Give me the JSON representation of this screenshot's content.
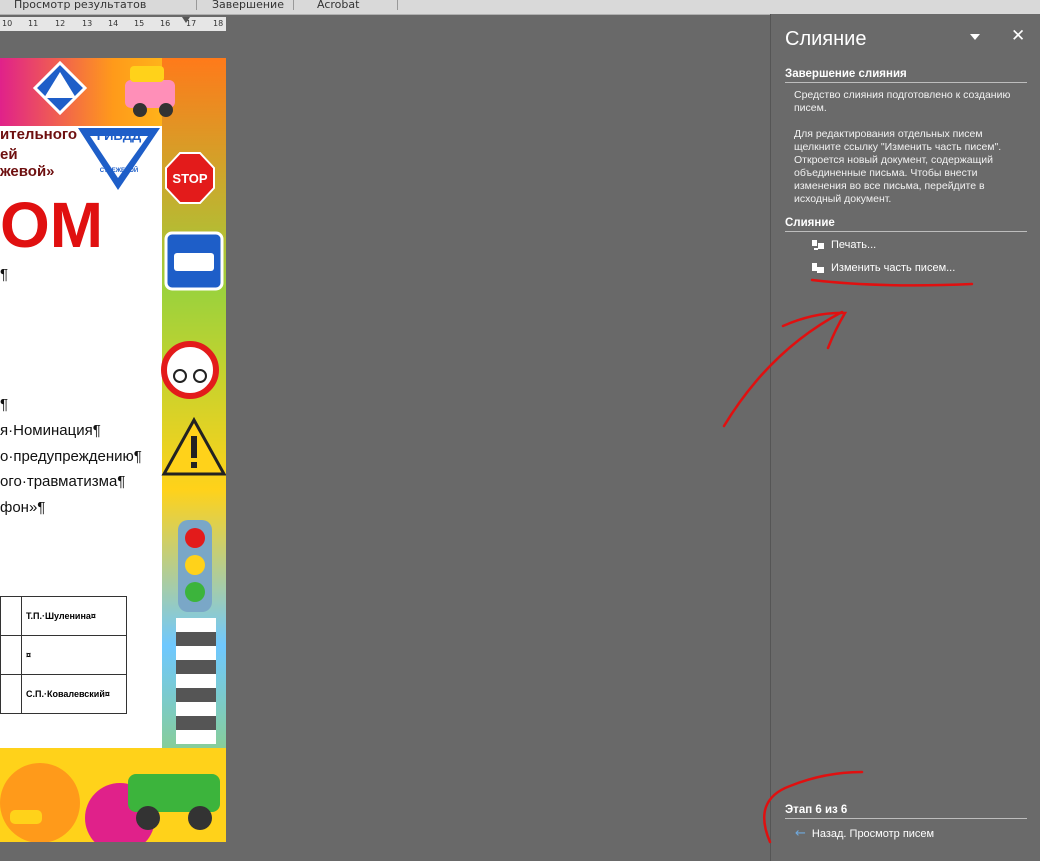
{
  "ribbon": {
    "groups": [
      "Просмотр результатов",
      "Завершение",
      "Acrobat"
    ]
  },
  "ruler": {
    "ticks": [
      "10",
      "11",
      "12",
      "13",
      "14",
      "15",
      "16",
      "17",
      "18"
    ]
  },
  "document": {
    "header_lines": [
      "ительного",
      "ей",
      "жевой»"
    ],
    "gibdd_logo": "ГИБДД",
    "gibdd_subtext": "СТРЕЖЕВОЙ",
    "big_title": "ОМ",
    "body_lines": [
      "¶",
      "¶",
      "я·Номинация¶",
      "о·предупреждению¶",
      "ого·травматизма¶",
      "фон»¶"
    ],
    "signature_rows": [
      {
        "name": "Т.П.·Шуленина¤"
      },
      {
        "name": "¤"
      },
      {
        "name": "С.П.·Ковалевский¤"
      }
    ],
    "sign_stop": "STOP"
  },
  "pane": {
    "title": "Слияние",
    "dropdown_icon": "triangle-down",
    "close_icon": "x",
    "section1_title": "Завершение слияния",
    "para1": "Средство слияния подготовлено к созданию писем.",
    "para2": "Для редактирования отдельных писем щелкните ссылку \"Изменить часть писем\". Откроется новый документ, содержащий объединенные письма. Чтобы внести изменения во все письма, перейдите в исходный документ.",
    "section2_title": "Слияние",
    "print_label": "Печать...",
    "edit_label": "Изменить часть писем...",
    "step_title": "Этап 6 из 6",
    "back_label": "Назад. Просмотр писем"
  },
  "colors": {
    "pane_bg": "#6a6a6a",
    "workspace_bg": "#696969",
    "annotation": "#e01010",
    "back_arrow": "#6fa8dc"
  }
}
